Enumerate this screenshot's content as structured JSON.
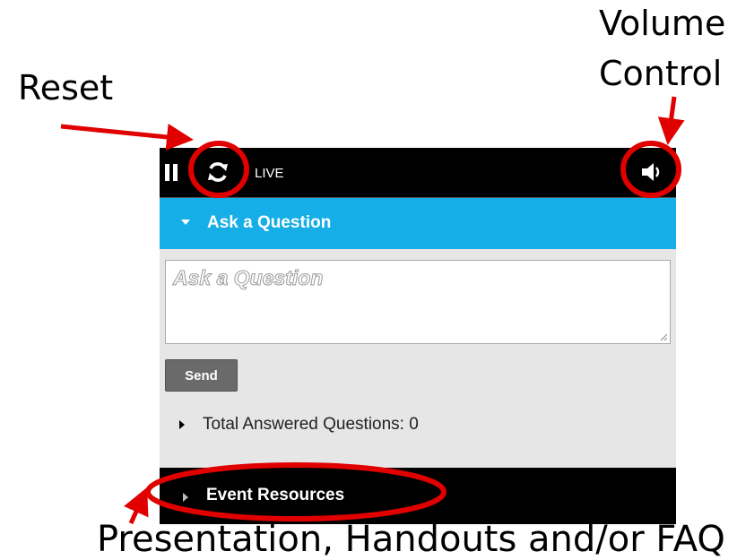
{
  "annotations": {
    "reset": "Reset",
    "volume_line1": "Volume",
    "volume_line2": "Control",
    "presentation": "Presentation, Handouts and/or FAQ"
  },
  "player": {
    "status": "LIVE",
    "icons": {
      "pause": "pause-icon",
      "reset": "refresh-icon",
      "volume": "speaker-icon"
    }
  },
  "ask_section": {
    "title": "Ask a Question",
    "placeholder": "Ask a Question",
    "send_label": "Send"
  },
  "answered": {
    "label": "Total Answered Questions: 0"
  },
  "resources": {
    "label": "Event Resources"
  },
  "colors": {
    "header_blue": "#16aee6",
    "annotation_red": "#e00000",
    "bar_black": "#000000",
    "panel_gray": "#e6e6e6"
  }
}
